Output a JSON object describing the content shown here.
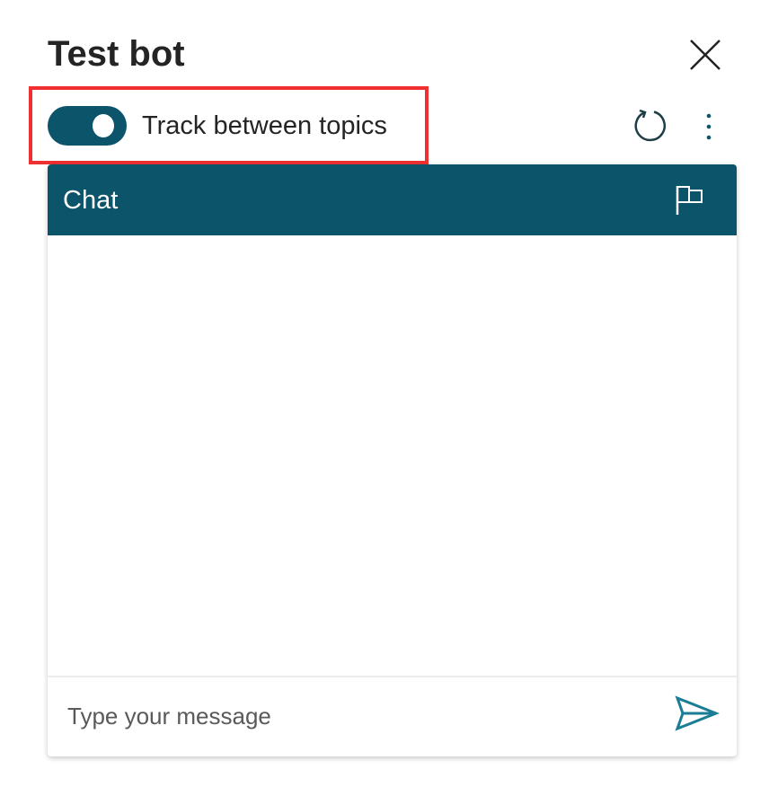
{
  "header": {
    "title": "Test bot",
    "close_icon": "close-icon"
  },
  "toolbar": {
    "toggle_label": "Track between topics",
    "toggle_on": true,
    "restart_icon": "restart-icon",
    "more_icon": "more-vertical-icon"
  },
  "chat": {
    "title": "Chat",
    "flag_icon": "flag-icon",
    "input_placeholder": "Type your message",
    "input_value": "",
    "send_icon": "send-icon"
  },
  "colors": {
    "accent": "#0b5469",
    "highlight": "#f03030",
    "send": "#1a7d96"
  }
}
